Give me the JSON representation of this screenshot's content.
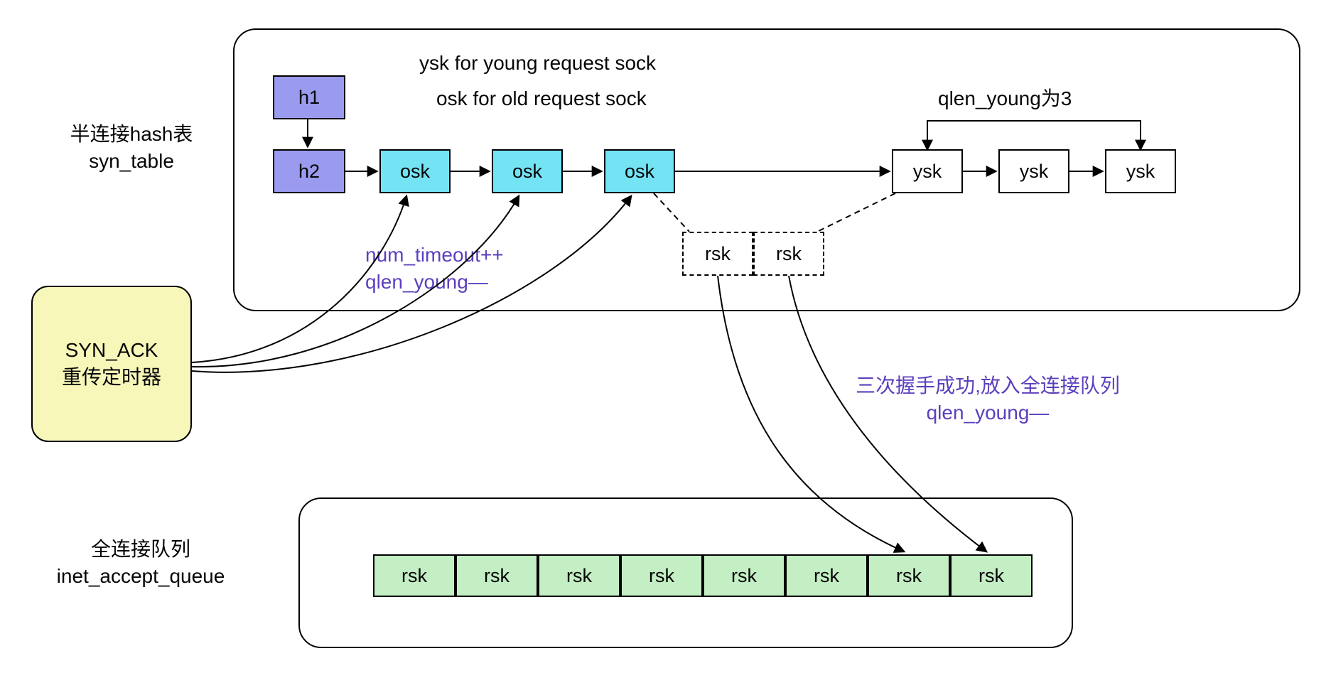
{
  "labels": {
    "syn_table_title_l1": "半连接hash表",
    "syn_table_title_l2": "syn_table",
    "accept_title_l1": "全连接队列",
    "accept_title_l2": "inet_accept_queue",
    "ysk_desc": "ysk for young request sock",
    "osk_desc": "osk for old request sock",
    "qlen_young_3": "qlen_young为3",
    "num_timeout": "num_timeout++",
    "qlen_young_dec1": "qlen_young—",
    "handshake_ok": "三次握手成功,放入全连接队列",
    "qlen_young_dec2": "qlen_young—",
    "syn_ack_timer_l1": "SYN_ACK",
    "syn_ack_timer_l2": "重传定时器"
  },
  "nodes": {
    "h1": "h1",
    "h2": "h2",
    "osk": "osk",
    "ysk": "ysk",
    "rsk": "rsk"
  },
  "queue": {
    "rsk_cells": [
      "rsk",
      "rsk",
      "rsk",
      "rsk",
      "rsk",
      "rsk",
      "rsk",
      "rsk"
    ]
  }
}
